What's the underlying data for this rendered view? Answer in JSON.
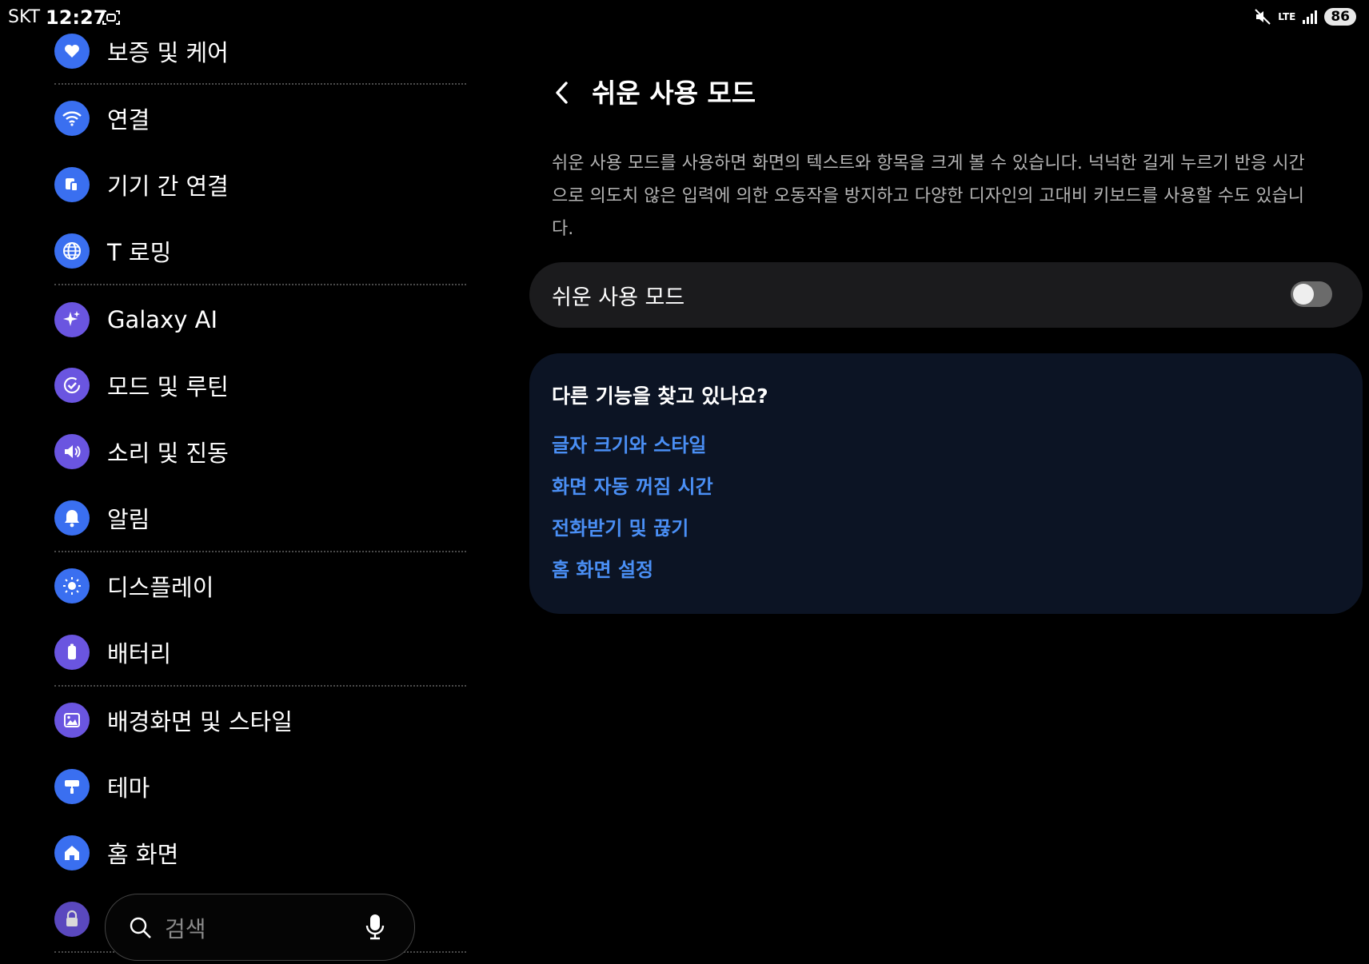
{
  "status_bar": {
    "carrier": "SKT",
    "time": "12:27",
    "network": "LTE",
    "battery": "86"
  },
  "sidebar": {
    "items": [
      {
        "label": "보증 및 케어",
        "icon": "heart-shield-icon",
        "color": "#3a6ff0"
      },
      {
        "label": "연결",
        "icon": "wifi-icon",
        "color": "#3a6ff0"
      },
      {
        "label": "기기 간 연결",
        "icon": "devices-icon",
        "color": "#3a6ff0"
      },
      {
        "label": "T 로밍",
        "icon": "globe-icon",
        "color": "#3a6ff0"
      },
      {
        "label": "Galaxy AI",
        "icon": "sparkle-icon",
        "color": "#6a55e0"
      },
      {
        "label": "모드 및 루틴",
        "icon": "routine-check-icon",
        "color": "#6a55e0"
      },
      {
        "label": "소리 및 진동",
        "icon": "speaker-icon",
        "color": "#6a55e0"
      },
      {
        "label": "알림",
        "icon": "bell-icon",
        "color": "#3a6ff0"
      },
      {
        "label": "디스플레이",
        "icon": "sun-icon",
        "color": "#3a6ff0"
      },
      {
        "label": "배터리",
        "icon": "battery-icon",
        "color": "#6a55e0"
      },
      {
        "label": "배경화면 및 스타일",
        "icon": "image-icon",
        "color": "#6a55e0"
      },
      {
        "label": "테마",
        "icon": "paintbrush-icon",
        "color": "#3a6ff0"
      },
      {
        "label": "홈 화면",
        "icon": "home-icon",
        "color": "#3a6ff0"
      }
    ]
  },
  "search": {
    "placeholder": "검색"
  },
  "detail": {
    "title": "쉬운 사용 모드",
    "description": "쉬운 사용 모드를 사용하면 화면의 텍스트와 항목을 크게 볼 수 있습니다. 넉넉한 길게 누르기 반응 시간으로 의도치 않은 입력에 의한 오동작을 방지하고 다양한 디자인의 고대비 키보드를 사용할 수도 있습니다.",
    "toggle": {
      "label": "쉬운 사용 모드",
      "enabled": false
    },
    "suggestions": {
      "title": "다른 기능을 찾고 있나요?",
      "links": [
        "글자 크기와 스타일",
        "화면 자동 꺼짐 시간",
        "전화받기 및 끊기",
        "홈 화면 설정"
      ]
    }
  },
  "colors": {
    "link": "#4a8ff5",
    "card_bg": "#1b1b1d",
    "suggest_bg": "#0c1424"
  }
}
